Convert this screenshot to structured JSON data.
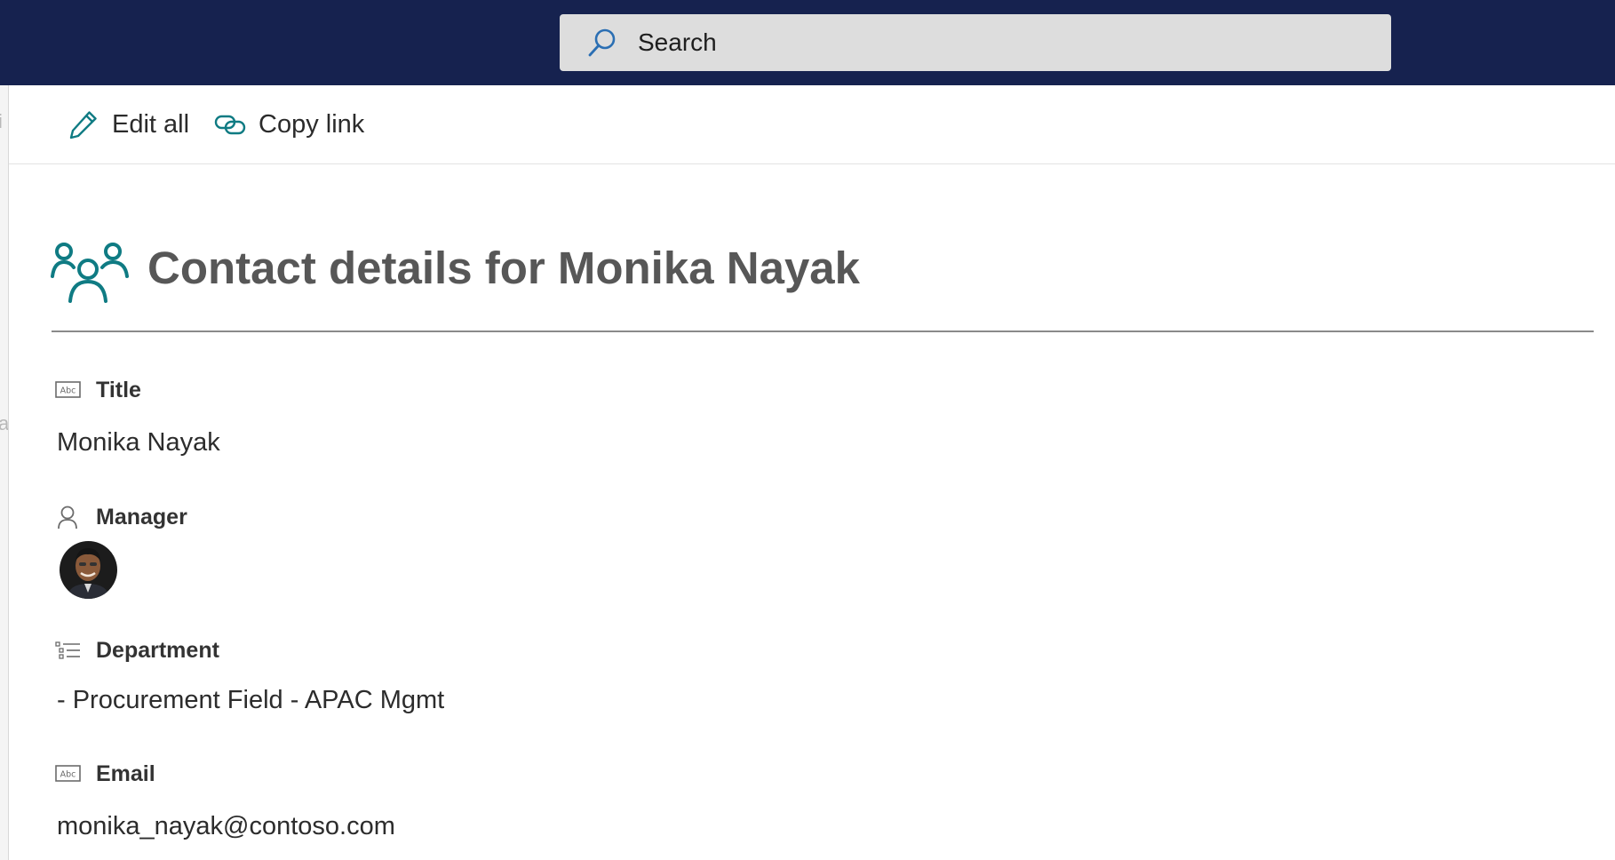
{
  "search": {
    "placeholder": "Search",
    "icon": "search-icon"
  },
  "left_strip": {
    "glyphs": [
      "i",
      "a"
    ]
  },
  "commandbar": {
    "edit_all": {
      "label": "Edit all",
      "icon": "pencil-icon"
    },
    "copy_link": {
      "label": "Copy link",
      "icon": "link-icon"
    }
  },
  "page": {
    "title": "Contact details for Monika Nayak",
    "icon": "people-group-icon"
  },
  "fields": {
    "title": {
      "label": "Title",
      "value": "Monika Nayak",
      "icon": "text-field-icon"
    },
    "manager": {
      "label": "Manager",
      "icon": "person-icon",
      "avatar": "manager-avatar"
    },
    "department": {
      "label": "Department",
      "value": "- Procurement Field - APAC Mgmt",
      "icon": "choice-list-icon"
    },
    "email": {
      "label": "Email",
      "value": "monika_nayak@contoso.com",
      "icon": "text-field-icon"
    }
  },
  "colors": {
    "topbar": "#16224f",
    "accent_teal": "#0f7b83",
    "search_icon_blue": "#2b6fb3",
    "title_text": "#575757"
  }
}
